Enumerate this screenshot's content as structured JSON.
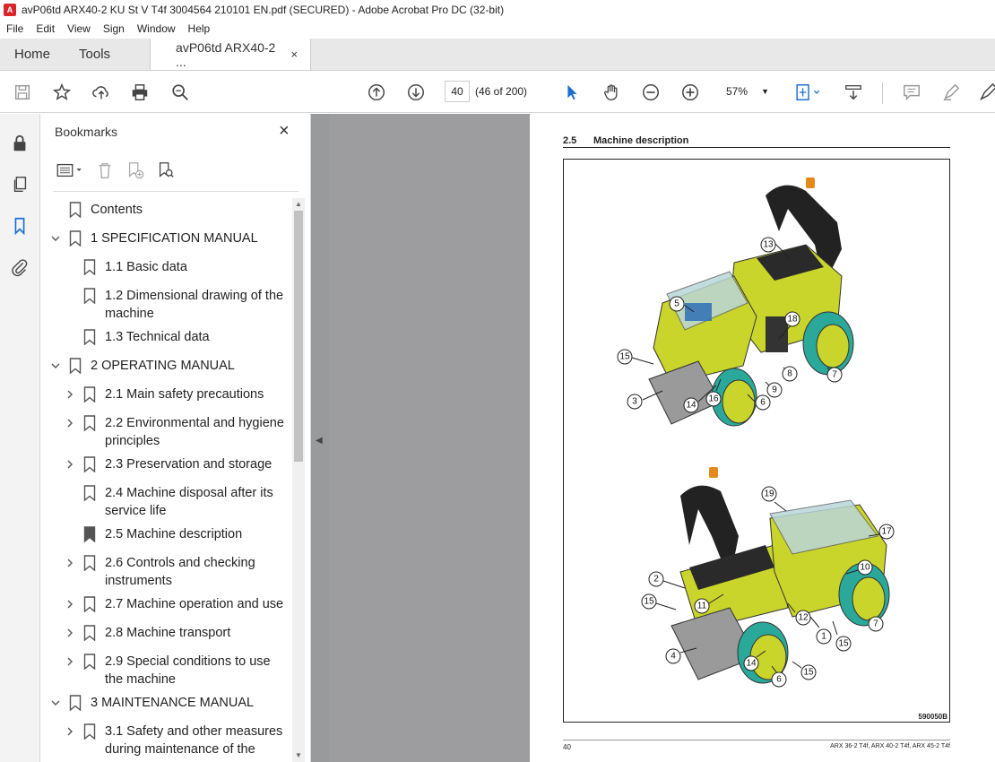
{
  "window": {
    "title": "avP06td ARX40-2 KU St V T4f 3004564 210101 EN.pdf (SECURED) - Adobe Acrobat Pro DC (32-bit)"
  },
  "menu": [
    "File",
    "Edit",
    "View",
    "Sign",
    "Window",
    "Help"
  ],
  "tabs": {
    "home": "Home",
    "tools": "Tools",
    "document": "avP06td ARX40-2 ...",
    "close": "×"
  },
  "toolbar": {
    "page_current": "40",
    "page_count": "(46 of 200)",
    "zoom": "57%",
    "icons": [
      "save-icon",
      "star-icon",
      "upload-icon",
      "print-icon",
      "search-icon",
      "page-up-icon",
      "page-down-icon",
      "cursor-icon",
      "hand-icon",
      "zoom-out-icon",
      "zoom-in-icon",
      "fit-icon",
      "scroll-mode-icon",
      "comment-icon",
      "highlight-icon",
      "sign-icon"
    ]
  },
  "bookmarks": {
    "header": "Bookmarks",
    "close": "×",
    "items": [
      {
        "label": "Contents",
        "level": 0,
        "chevron": ""
      },
      {
        "label": "1 SPECIFICATION MANUAL",
        "level": 0,
        "chevron": "down"
      },
      {
        "label": "1.1 Basic data",
        "level": 1,
        "chevron": ""
      },
      {
        "label": "1.2 Dimensional drawing of the machine",
        "level": 1,
        "chevron": ""
      },
      {
        "label": "1.3 Technical data",
        "level": 1,
        "chevron": ""
      },
      {
        "label": "2 OPERATING MANUAL",
        "level": 0,
        "chevron": "down"
      },
      {
        "label": "2.1 Main safety precautions",
        "level": 1,
        "chevron": "right"
      },
      {
        "label": "2.2 Environmental and hygiene principles",
        "level": 1,
        "chevron": "right"
      },
      {
        "label": "2.3 Preservation and storage",
        "level": 1,
        "chevron": "right"
      },
      {
        "label": "2.4 Machine disposal after its service life",
        "level": 1,
        "chevron": ""
      },
      {
        "label": "2.5 Machine description",
        "level": 1,
        "chevron": ""
      },
      {
        "label": "2.6 Controls and checking instruments",
        "level": 1,
        "chevron": "right"
      },
      {
        "label": "2.7 Machine operation and use",
        "level": 1,
        "chevron": "right"
      },
      {
        "label": "2.8 Machine transport",
        "level": 1,
        "chevron": "right"
      },
      {
        "label": "2.9 Special conditions to use the machine",
        "level": 1,
        "chevron": "right"
      },
      {
        "label": "3 MAINTENANCE MANUAL",
        "level": 0,
        "chevron": "down"
      },
      {
        "label": "3.1 Safety and other measures during maintenance of the",
        "level": 1,
        "chevron": "right"
      }
    ]
  },
  "page": {
    "section_number": "2.5",
    "section_title": "Machine description",
    "figure_code": "590050B",
    "page_number": "40",
    "footer_models": "ARX 36-2 T4f, ARX 40-2 T4f, ARX 45-2 T4f",
    "callouts_top": [
      "13",
      "5",
      "18",
      "15",
      "7",
      "8",
      "9",
      "3",
      "14",
      "16",
      "6"
    ],
    "callouts_bottom": [
      "19",
      "17",
      "10",
      "2",
      "11",
      "15",
      "12",
      "7",
      "1",
      "15",
      "4",
      "14",
      "6",
      "15"
    ]
  },
  "colors": {
    "accent_yellow": "#c9d52a",
    "teal": "#2aa89a",
    "viewer_bg": "#999a9c"
  }
}
